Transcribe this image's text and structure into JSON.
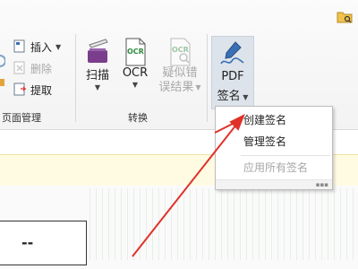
{
  "ribbon": {
    "page_group": {
      "label": "页面管理",
      "insert": "插入",
      "delete": "删除",
      "extract": "提取"
    },
    "convert_group": {
      "label": "转换",
      "scan": "扫描",
      "ocr": "OCR",
      "ocr_icon_text": "OCR",
      "suspect_line1": "疑似错",
      "suspect_line2": "误结果"
    },
    "sign": {
      "line1": "PDF",
      "line2": "签名"
    }
  },
  "menu": {
    "create_signature": "创建签名",
    "manage_signature": "管理签名",
    "apply_all_signatures": "应用所有签名"
  },
  "document": {
    "box_text": "--"
  },
  "colors": {
    "accent_blue": "#3a6fb5",
    "scanner_purple": "#7b3e8c",
    "ocr_green": "#2e8b3e",
    "annotation_red": "#e0322a",
    "notice_yellow": "#fffbe3"
  }
}
